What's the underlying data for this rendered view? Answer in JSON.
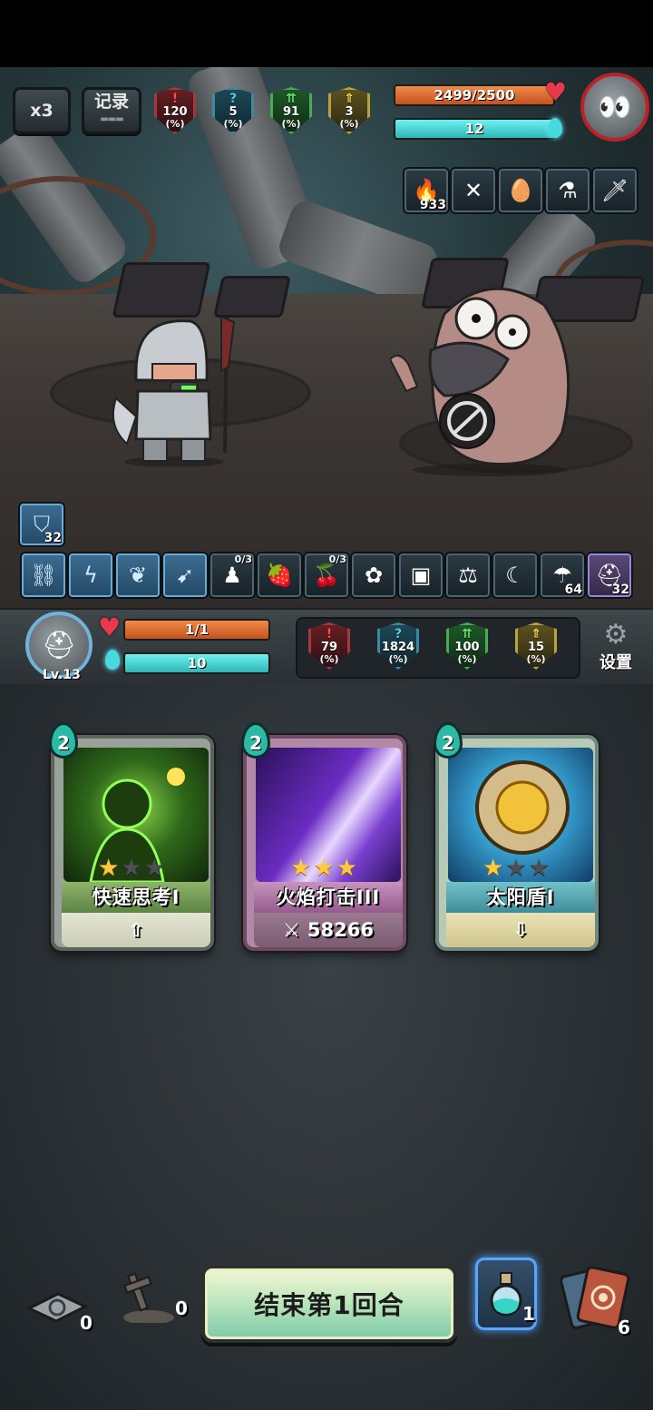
{
  "top_hud": {
    "speed_label": "x3",
    "log_label": "记录",
    "enemy_stats": [
      {
        "value": "120",
        "unit": "(%)",
        "glyph": "!",
        "color": "red"
      },
      {
        "value": "5",
        "unit": "(%)",
        "glyph": "?",
        "color": "blue"
      },
      {
        "value": "91",
        "unit": "(%)",
        "glyph": "⇈",
        "color": "green"
      },
      {
        "value": "3",
        "unit": "(%)",
        "glyph": "⇑",
        "color": "yellow"
      }
    ],
    "enemy_hp": {
      "text": "2499/2500",
      "fraction": 0.9996
    },
    "enemy_mana": {
      "text": "12",
      "fraction": 1.0
    },
    "enemy_relics": [
      {
        "icon": "fire-icon",
        "count": "933"
      },
      {
        "icon": "crossbow-icon",
        "count": ""
      },
      {
        "icon": "egg-icon",
        "count": ""
      },
      {
        "icon": "potion-flask-icon",
        "count": ""
      },
      {
        "icon": "sword-icon",
        "count": ""
      }
    ]
  },
  "hero_buffs": {
    "shield": {
      "icon": "shield-icon",
      "count": "32"
    },
    "skills": [
      {
        "icon": "chain-icon",
        "count": ""
      },
      {
        "icon": "lightning-icon",
        "count": ""
      },
      {
        "icon": "leaf-icon",
        "count": ""
      },
      {
        "icon": "dash-icon",
        "count": ""
      }
    ],
    "relics": [
      {
        "icon": "soldier-icon",
        "count": "",
        "top": "0/3"
      },
      {
        "icon": "strawberry-icon",
        "count": "",
        "top": ""
      },
      {
        "icon": "berry-icon",
        "count": "",
        "top": "0/3"
      },
      {
        "icon": "lotus-icon",
        "count": "",
        "top": ""
      },
      {
        "icon": "crate-icon",
        "count": "",
        "top": ""
      },
      {
        "icon": "scales-icon",
        "count": "",
        "top": ""
      },
      {
        "icon": "fang-icon",
        "count": "",
        "top": ""
      },
      {
        "icon": "mushroom-icon",
        "count": "64",
        "top": ""
      },
      {
        "icon": "helmet-icon",
        "count": "32",
        "top": ""
      }
    ]
  },
  "hero_status": {
    "level": "Lv.13",
    "hp": {
      "text": "1/1",
      "fraction": 1.0
    },
    "mana": {
      "text": "10",
      "fraction": 1.0
    },
    "stats": [
      {
        "value": "79",
        "unit": "(%)",
        "glyph": "!",
        "color": "red"
      },
      {
        "value": "1824",
        "unit": "(%)",
        "glyph": "?",
        "color": "blue"
      },
      {
        "value": "100",
        "unit": "(%)",
        "glyph": "⇈",
        "color": "green"
      },
      {
        "value": "15",
        "unit": "(%)",
        "glyph": "⇑",
        "color": "yellow"
      }
    ],
    "settings_label": "设置"
  },
  "hand": [
    {
      "cost": "2",
      "name": "快速思考I",
      "stars": 1,
      "footer": "",
      "footer_icon": "arrow-up-icon",
      "theme": "green"
    },
    {
      "cost": "2",
      "name": "火焰打击III",
      "stars": 3,
      "footer": "58266",
      "footer_icon": "sword-swing-icon",
      "theme": "purple"
    },
    {
      "cost": "2",
      "name": "太阳盾I",
      "stars": 1,
      "footer": "",
      "footer_icon": "arrow-down-icon",
      "theme": "teal"
    }
  ],
  "bottom": {
    "draw_pile_count": "0",
    "grave_count": "0",
    "end_turn_label": "结束第1回合",
    "potion_count": "1",
    "discard_count": "6"
  },
  "colors": {
    "hp": "#d9602a",
    "mana": "#3fc9c9",
    "star_on": "#ffc93c",
    "star_off": "#4b4f55"
  }
}
